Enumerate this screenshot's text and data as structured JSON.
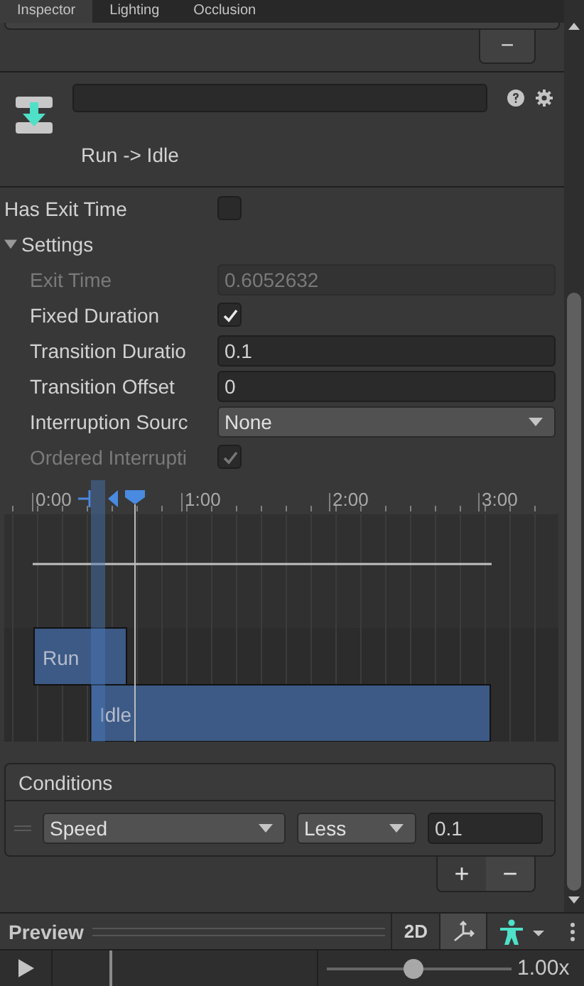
{
  "tabs": [
    {
      "label": "Inspector",
      "selected": true
    },
    {
      "label": "Lighting",
      "selected": false
    },
    {
      "label": "Occlusion",
      "selected": false
    }
  ],
  "top_panel": {
    "remove_button": "−"
  },
  "header": {
    "title": "Run -> Idle"
  },
  "properties": [
    {
      "kind": "checkbox",
      "label": "Has Exit Time",
      "checked": false,
      "disabled": false
    },
    {
      "kind": "foldout",
      "label": "Settings",
      "expanded": true,
      "children": [
        {
          "kind": "number",
          "label": "Exit Time",
          "value": "0.6052632",
          "disabled": true
        },
        {
          "kind": "checkbox",
          "label": "Fixed Duration",
          "checked": true,
          "disabled": false
        },
        {
          "kind": "number",
          "label": "Transition Duratio",
          "value": "0.1",
          "disabled": false
        },
        {
          "kind": "number",
          "label": "Transition Offset",
          "value": "0",
          "disabled": false
        },
        {
          "kind": "dropdown",
          "label": "Interruption Sourc",
          "value": "None",
          "disabled": false
        },
        {
          "kind": "checkbox",
          "label": "Ordered Interrupti",
          "checked": true,
          "disabled": true
        }
      ]
    }
  ],
  "timeline": {
    "ruler_labels": [
      "0:00",
      "1:00",
      "2:00",
      "3:00"
    ],
    "clips": [
      {
        "label": "Run"
      },
      {
        "label": "Idle"
      }
    ]
  },
  "conditions": {
    "title": "Conditions",
    "rows": [
      {
        "parameter": "Speed",
        "mode": "Less",
        "value": "0.1"
      }
    ],
    "add_button": "+",
    "remove_button": "−"
  },
  "preview": {
    "title": "Preview",
    "mode_button": "2D",
    "speed": {
      "level": 0.47,
      "reading": "1.00x"
    }
  }
}
